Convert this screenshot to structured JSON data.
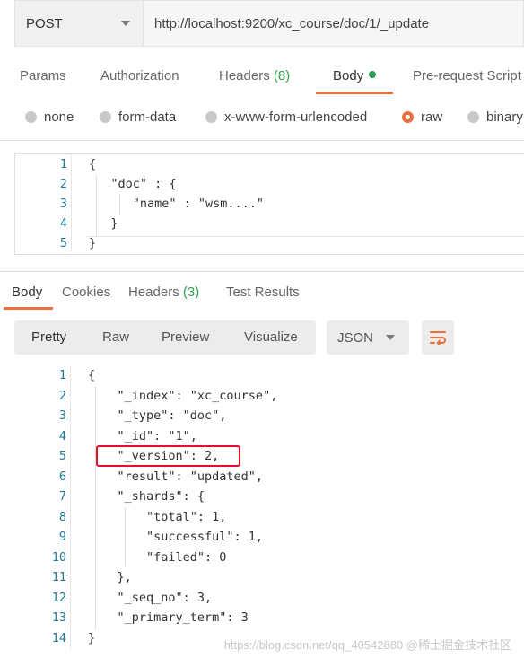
{
  "request": {
    "method": "POST",
    "url": "http://localhost:9200/xc_course/doc/1/_update",
    "tabs": {
      "params": "Params",
      "authorization": "Authorization",
      "headers": "Headers",
      "headers_count": "(8)",
      "body": "Body",
      "prerequest": "Pre-request Script"
    },
    "body_types": {
      "none": "none",
      "form_data": "form-data",
      "urlencoded": "x-www-form-urlencoded",
      "raw": "raw",
      "binary": "binary"
    },
    "selected_body_type": "raw",
    "lines": [
      {
        "n": "1",
        "text": "{"
      },
      {
        "n": "2",
        "text": "   \"doc\" : {"
      },
      {
        "n": "3",
        "text": "      \"name\" : \"wsm....\""
      },
      {
        "n": "4",
        "text": "   }"
      },
      {
        "n": "5",
        "text": "}"
      }
    ]
  },
  "response": {
    "tabs": {
      "body": "Body",
      "cookies": "Cookies",
      "headers": "Headers",
      "headers_count": "(3)",
      "test_results": "Test Results"
    },
    "views": {
      "pretty": "Pretty",
      "raw": "Raw",
      "preview": "Preview",
      "visualize": "Visualize"
    },
    "format": "JSON",
    "lines": [
      {
        "n": "1",
        "text": "{"
      },
      {
        "n": "2",
        "text": "    \"_index\": \"xc_course\","
      },
      {
        "n": "3",
        "text": "    \"_type\": \"doc\","
      },
      {
        "n": "4",
        "text": "    \"_id\": \"1\","
      },
      {
        "n": "5",
        "text": "    \"_version\": 2,"
      },
      {
        "n": "6",
        "text": "    \"result\": \"updated\","
      },
      {
        "n": "7",
        "text": "    \"_shards\": {"
      },
      {
        "n": "8",
        "text": "        \"total\": 1,"
      },
      {
        "n": "9",
        "text": "        \"successful\": 1,"
      },
      {
        "n": "10",
        "text": "        \"failed\": 0"
      },
      {
        "n": "11",
        "text": "    },"
      },
      {
        "n": "12",
        "text": "    \"_seq_no\": 3,"
      },
      {
        "n": "13",
        "text": "    \"_primary_term\": 3"
      },
      {
        "n": "14",
        "text": "}"
      }
    ]
  },
  "watermark": "https://blog.csdn.net/qq_40542880  @稀土掘金技术社区",
  "colors": {
    "accent": "#e9703c",
    "count": "#2e9e52",
    "highlight_box": "#e3102b"
  }
}
